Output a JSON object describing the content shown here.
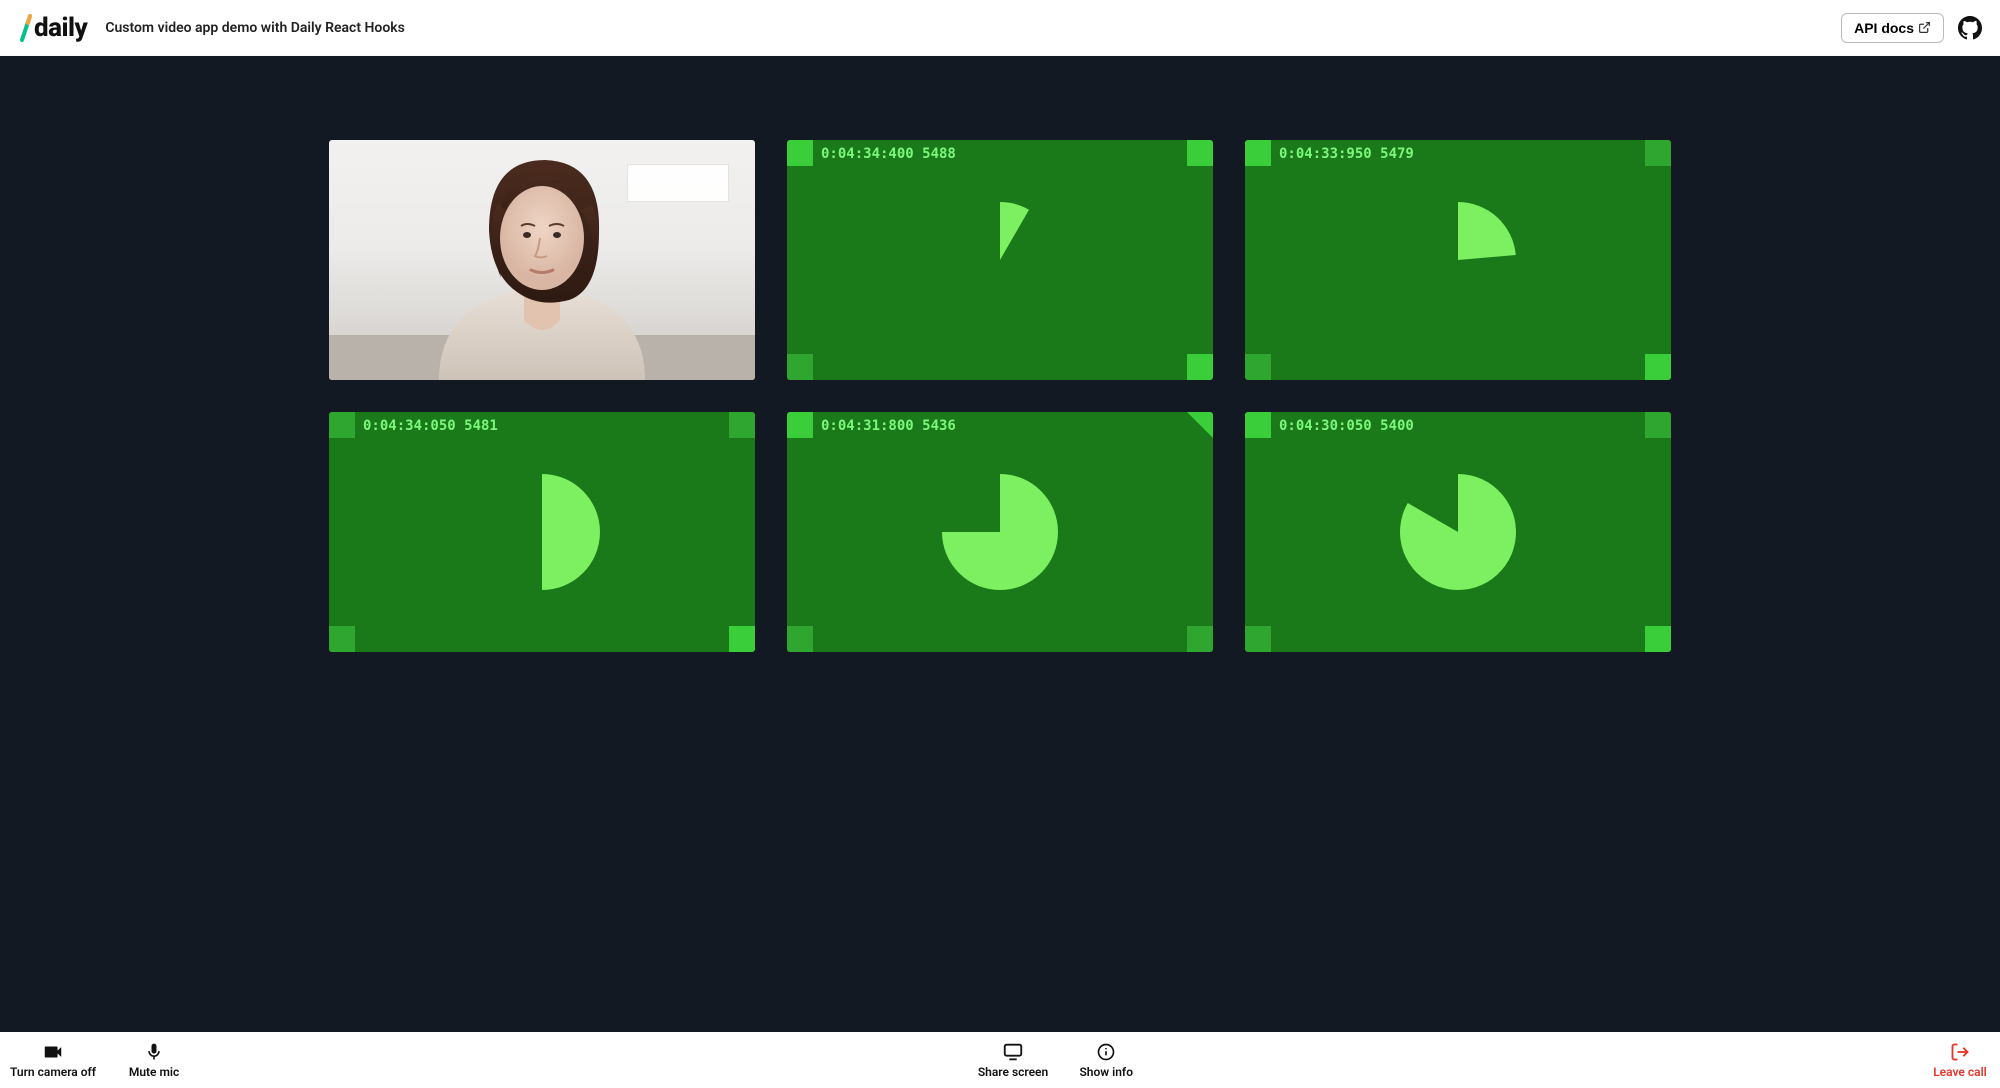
{
  "header": {
    "brand": "daily",
    "title": "Custom video app demo with Daily React Hooks",
    "api_docs_label": "API docs"
  },
  "tiles": [
    {
      "kind": "camera"
    },
    {
      "kind": "fake",
      "timestamp": "0:04:34:400 5488",
      "angle": 30,
      "tl": "l",
      "tr": "l",
      "bl": "d",
      "br": "l"
    },
    {
      "kind": "fake",
      "timestamp": "0:04:33:950 5479",
      "angle": 85,
      "tl": "l",
      "tr": "d",
      "bl": "d",
      "br": "l"
    },
    {
      "kind": "fake",
      "timestamp": "0:04:34:050 5481",
      "angle": 180,
      "tl": "d",
      "tr": "d",
      "bl": "d",
      "br": "l"
    },
    {
      "kind": "fake",
      "timestamp": "0:04:31:800 5436",
      "angle": 270,
      "tl": "l",
      "tr": "tri",
      "bl": "d",
      "br": "d"
    },
    {
      "kind": "fake",
      "timestamp": "0:04:30:050 5400",
      "angle": 300,
      "tl": "l",
      "tr": "d",
      "bl": "d",
      "br": "l"
    }
  ],
  "tray": {
    "camera_label": "Turn camera off",
    "mic_label": "Mute mic",
    "share_label": "Share screen",
    "info_label": "Show info",
    "leave_label": "Leave call"
  }
}
